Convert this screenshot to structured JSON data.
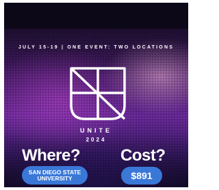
{
  "event": {
    "tagline": "JULY 15-19   |   ONE EVENT: TWO LOCATIONS",
    "brand": "UNITE",
    "year": "2024"
  },
  "where": {
    "heading": "Where?",
    "location_line1": "SAN DIEGO STATE",
    "location_line2": "UNIVERSITY"
  },
  "cost": {
    "heading": "Cost?",
    "price": "$891"
  },
  "colors": {
    "pill_blue": "#3a78d8",
    "background_dark": "#0a0716",
    "stage_purple": "#6a2a9a"
  },
  "icons": {
    "logo": "unite-shield-logo"
  }
}
